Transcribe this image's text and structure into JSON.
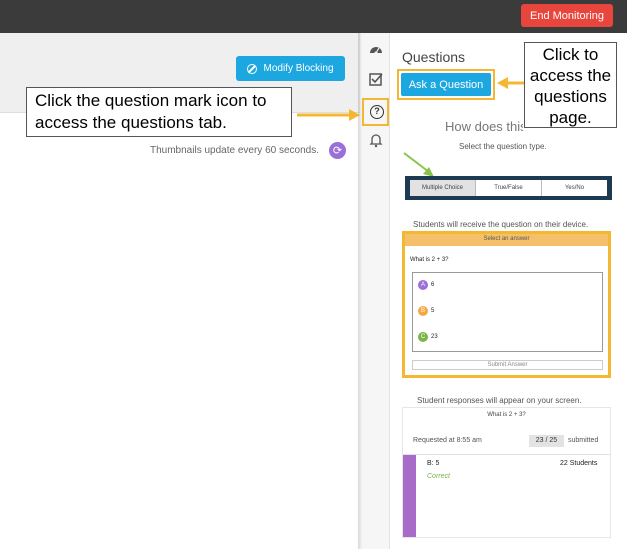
{
  "header": {
    "end_monitoring_label": "End Monitoring"
  },
  "left": {
    "modify_blocking_label": "Modify Blocking",
    "thumbnails_note": "Thumbnails update every 60 seconds."
  },
  "callouts": {
    "question_mark": "Click the question mark icon to access the questions tab.",
    "questions_page": "Click to access the questions page."
  },
  "sidebar_icons": [
    "dashboard-icon",
    "checkbox-icon",
    "question-icon",
    "bell-icon"
  ],
  "panel": {
    "title": "Questions",
    "ask_button_label": "Ask a Question",
    "how_does_text": "How does this",
    "select_type_text": "Select the question type.",
    "question_types": [
      "Multiple Choice",
      "True/False",
      "Yes/No"
    ],
    "selected_type": "Multiple Choice",
    "receive_note": "Students will receive the question on their device.",
    "device_preview": {
      "header": "Select an answer",
      "question": "What is 2 + 3?",
      "answers": [
        {
          "letter": "A",
          "text": "6",
          "color": "#9b6fd9"
        },
        {
          "letter": "B",
          "text": "5",
          "color": "#f4a742"
        },
        {
          "letter": "C",
          "text": "23",
          "color": "#7ab646"
        }
      ],
      "submit_label": "Submit Answer"
    },
    "responses_note": "Student responses will appear on your screen.",
    "responses": {
      "question": "What is 2 + 3?",
      "requested": "Requested at 8:55 am",
      "count": "23 / 25",
      "submitted_label": "submitted",
      "answer_label": "B: 5",
      "students": "22 Students",
      "status": "Correct"
    }
  },
  "colors": {
    "accent_blue": "#1ca7e0",
    "highlight_yellow": "#f4b731",
    "end_red": "#e8453c",
    "navy": "#1e3a52",
    "purple": "#a96bc9"
  }
}
